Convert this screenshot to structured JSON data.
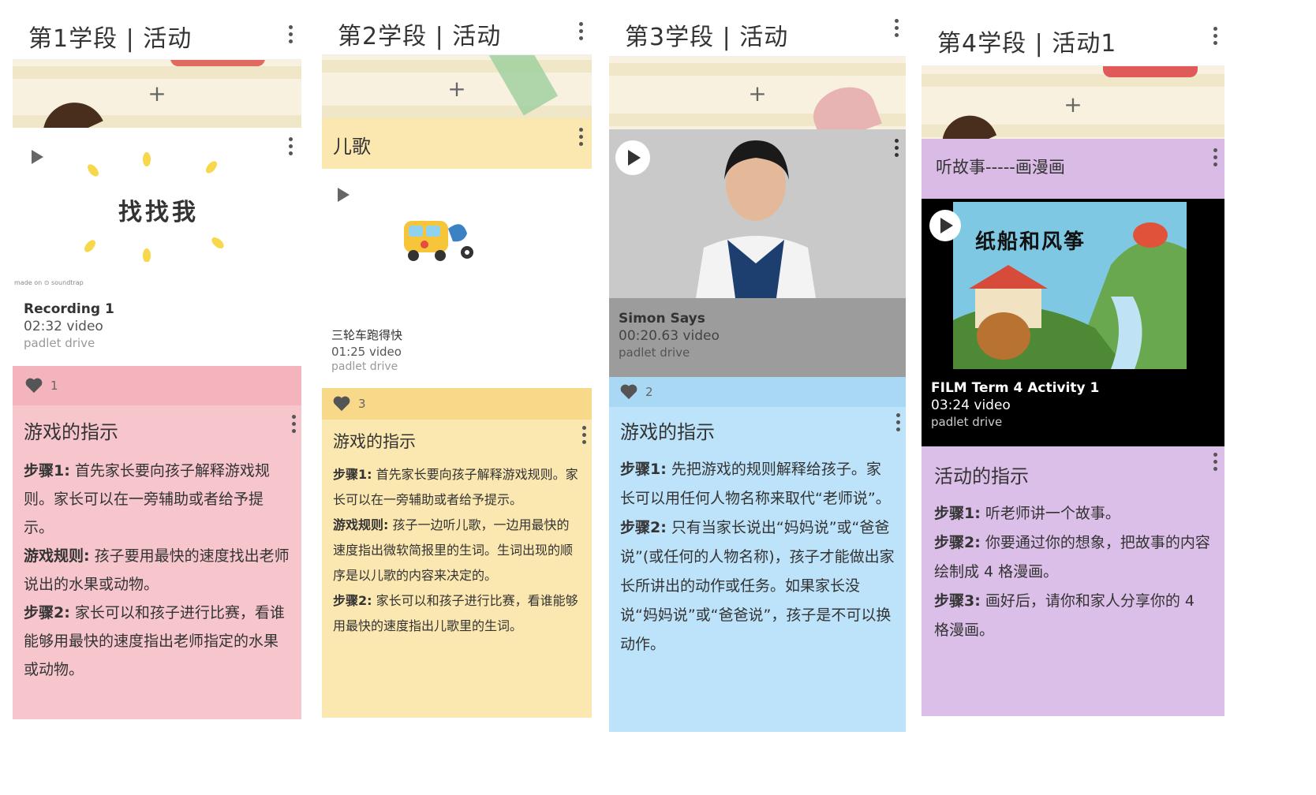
{
  "columns": [
    {
      "header": "第1学段 | 活动",
      "add_label": "+",
      "media": {
        "cover_text": "找找我",
        "watermark": "made on ⊙ soundtrap",
        "name": "Recording 1",
        "duration": "02:32 video",
        "source": "padlet drive"
      },
      "likes": "1",
      "post": {
        "title": "游戏的指示",
        "steps": [
          {
            "label": "步骤1:",
            "text": " 首先家长要向孩子解释游戏规则。家长可以在一旁辅助或者给予提示。"
          },
          {
            "label": "游戏规则:",
            "text": " 孩子要用最快的速度找出老师说出的水果或动物。"
          },
          {
            "label": "步骤2:",
            "text": " 家长可以和孩子进行比赛，看谁能够用最快的速度指出老师指定的水果或动物。"
          }
        ]
      }
    },
    {
      "header": "第2学段 | 活动",
      "add_label": "+",
      "section": "儿歌",
      "media": {
        "name": "三轮车跑得快",
        "duration": "01:25 video",
        "source": "padlet drive"
      },
      "likes": "3",
      "post": {
        "title": "游戏的指示",
        "steps": [
          {
            "label": "步骤1:",
            "text": " 首先家长要向孩子解释游戏规则。家长可以在一旁辅助或者给予提示。"
          },
          {
            "label": "游戏规则:",
            "text": " 孩子一边听儿歌，一边用最快的速度指出微软简报里的生词。生词出现的顺序是以儿歌的内容来决定的。"
          },
          {
            "label": "步骤2:",
            "text": " 家长可以和孩子进行比赛，看谁能够用最快的速度指出儿歌里的生词。"
          }
        ]
      }
    },
    {
      "header": "第3学段 | 活动",
      "add_label": "+",
      "media": {
        "name": "Simon Says",
        "duration": "00:20.63 video",
        "source": "padlet drive"
      },
      "likes": "2",
      "post": {
        "title": "游戏的指示",
        "steps": [
          {
            "label": "步骤1:",
            "text": " 先把游戏的规则解释给孩子。家长可以用任何人物名称来取代“老师说”。"
          },
          {
            "label": "步骤2:",
            "text": " 只有当家长说出“妈妈说”或“爸爸说”(或任何的人物名称)，孩子才能做出家长所讲出的动作或任务。如果家长没说“妈妈说”或“爸爸说”，孩子是不可以换动作。"
          }
        ]
      }
    },
    {
      "header": "第4学段 | 活动1",
      "add_label": "+",
      "section": "听故事-----画漫画",
      "media": {
        "cover_text": "纸船和风筝",
        "name": "FILM Term 4 Activity 1",
        "duration": "03:24 video",
        "source": "padlet drive"
      },
      "post": {
        "title": "活动的指示",
        "steps": [
          {
            "label": "步骤1:",
            "text": " 听老师讲一个故事。"
          },
          {
            "label": "步骤2:",
            "text": " 你要通过你的想象，把故事的内容绘制成 4 格漫画。"
          },
          {
            "label": "步骤3:",
            "text": " 画好后，请你和家人分享你的 4 格漫画。"
          }
        ]
      }
    }
  ],
  "colors": {
    "pink": "#f6c6cc",
    "yellow": "#fbe7b0",
    "blue": "#bde3fa",
    "purple": "#dcbfe9"
  }
}
